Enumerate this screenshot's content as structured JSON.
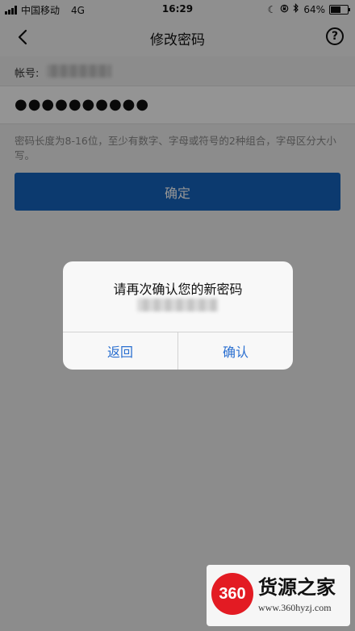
{
  "status_bar": {
    "carrier": "中国移动",
    "network": "4G",
    "time": "16:29",
    "battery": "64%",
    "battery_level": 0.64,
    "icons": [
      "moon-icon",
      "lock-rotation-icon",
      "bluetooth-icon",
      "battery-icon"
    ]
  },
  "nav": {
    "title": "修改密码",
    "back_icon": "chevron-left-icon",
    "help_icon": "question-circle-icon",
    "help_glyph": "?"
  },
  "form": {
    "account_label": "帐号:",
    "password_value": "●●●●●●●●●●",
    "hint": "密码长度为8-16位，至少有数字、字母或符号的2种组合，字母区分大小写。",
    "confirm_label": "确定"
  },
  "dialog": {
    "title": "请再次确认您的新密码",
    "cancel_label": "返回",
    "ok_label": "确认"
  },
  "watermark": {
    "logo_text": "360",
    "name": "货源之家",
    "url": "www.360hyzj.com"
  },
  "colors": {
    "primary": "#1565c0",
    "dialog_button": "#2a6fd0",
    "hint_text": "#8a8a8a",
    "watermark_logo": "#e31b23"
  }
}
